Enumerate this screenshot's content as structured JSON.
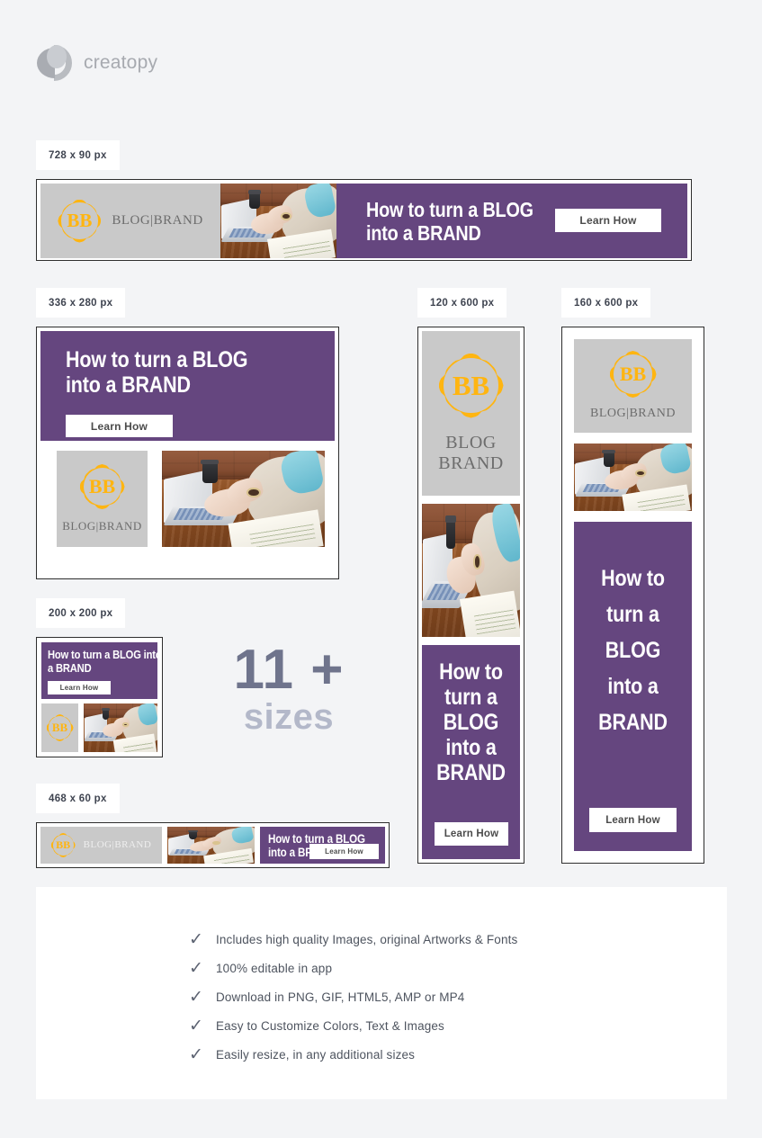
{
  "brand": {
    "name": "creatopy",
    "logo_icon": "creatopy-circle-logo"
  },
  "sizes": {
    "leaderboard": "728 x 90 px",
    "rectangle": "336 x 280 px",
    "skyscraper_120": "120 x 600 px",
    "skyscraper_160": "160 x 600 px",
    "square": "200 x 200 px",
    "banner": "468 x 60 px"
  },
  "ad": {
    "badge_text": "BB",
    "wordmark_inline": "BLOG|BRAND",
    "wordmark_line1": "BLOG",
    "wordmark_line2": "BRAND",
    "headline_line1": "How to turn a BLOG",
    "headline_line2": "into a BRAND",
    "headline_stacked": [
      "How to",
      "turn a",
      "BLOG",
      "into a",
      "BRAND"
    ],
    "square_headline_line1": "How to turn a BLOG into",
    "square_headline_line2": "a BRAND",
    "cta": "Learn How",
    "photo_alt": "person-typing-on-laptop-photo"
  },
  "callout": {
    "count": "11 +",
    "label": "sizes"
  },
  "features": {
    "check_icon": "check-icon",
    "items": [
      "Includes high quality Images, original Artworks & Fonts",
      "100% editable in app",
      "Download in PNG, GIF, HTML5, AMP or MP4",
      "Easy to Customize Colors, Text & Images",
      "Easily resize, in any additional sizes"
    ]
  },
  "colors": {
    "background": "#f3f4f6",
    "purple": "#65467f",
    "badge_gold": "#ffb511",
    "logo_gray": "#c9c9c9",
    "callout_dark": "#6f748c",
    "callout_light": "#b3b8c9"
  }
}
